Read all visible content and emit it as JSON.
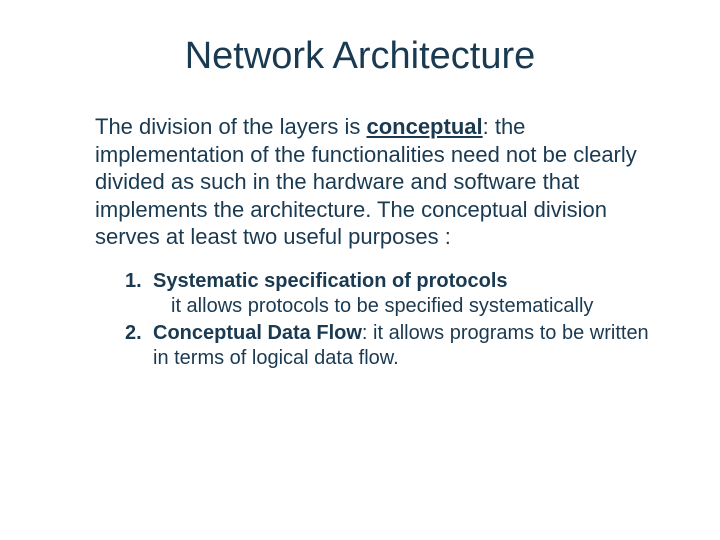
{
  "title": "Network Architecture",
  "paragraph": {
    "pre": "The division of the layers is ",
    "bold_underlined": "conceptual",
    "post": ": the implementation of the functionalities need not be clearly divided as such in the hardware and software that implements the architecture. The conceptual division serves at least two useful purposes :"
  },
  "list": {
    "items": [
      {
        "number": "1.",
        "title": "Systematic specification of protocols",
        "title_suffix": "",
        "sub": "it allows protocols to be specified systematically"
      },
      {
        "number": "2.",
        "title": "Conceptual Data Flow",
        "title_suffix": ": it allows programs to be written in terms of logical data flow.",
        "sub": ""
      }
    ]
  }
}
